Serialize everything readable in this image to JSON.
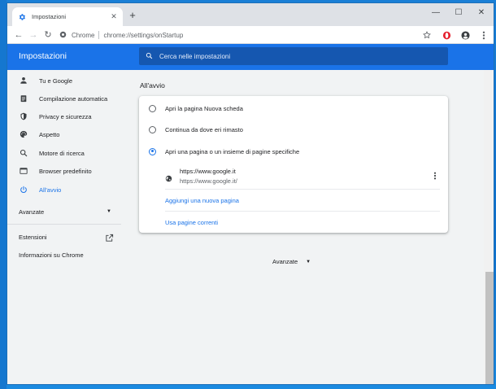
{
  "browser": {
    "tab_title": "Impostazioni",
    "tab_close": "✕",
    "new_tab": "+",
    "window_controls": {
      "minimize": "—",
      "maximize": "☐",
      "close": "✕"
    },
    "nav": {
      "back": "←",
      "forward": "→",
      "reload": "↻"
    },
    "omnibox": {
      "site_label": "Chrome",
      "url": "chrome://settings/onStartup"
    }
  },
  "settings": {
    "title": "Impostazioni",
    "search_placeholder": "Cerca nelle impostazioni",
    "accent": "#1a73e8"
  },
  "sidebar": {
    "items": [
      {
        "label": "Tu e Google",
        "icon": "person-icon"
      },
      {
        "label": "Compilazione automatica",
        "icon": "clipboard-icon"
      },
      {
        "label": "Privacy e sicurezza",
        "icon": "shield-icon"
      },
      {
        "label": "Aspetto",
        "icon": "palette-icon"
      },
      {
        "label": "Motore di ricerca",
        "icon": "search-icon"
      },
      {
        "label": "Browser predefinito",
        "icon": "browser-icon"
      },
      {
        "label": "All'avvio",
        "icon": "power-icon",
        "active": true
      }
    ],
    "advanced": "Avanzate",
    "extensions": "Estensioni",
    "about": "Informazioni su Chrome"
  },
  "main": {
    "section_title": "All'avvio",
    "options": [
      {
        "label": "Apri la pagina Nuova scheda",
        "checked": false
      },
      {
        "label": "Continua da dove eri rimasto",
        "checked": false
      },
      {
        "label": "Apri una pagina o un insieme di pagine specifiche",
        "checked": true
      }
    ],
    "page": {
      "title": "https://www.google.it",
      "url": "https://www.google.it/"
    },
    "add_page": "Aggiungi una nuova pagina",
    "use_current": "Usa pagine correnti",
    "advanced": "Avanzate"
  }
}
